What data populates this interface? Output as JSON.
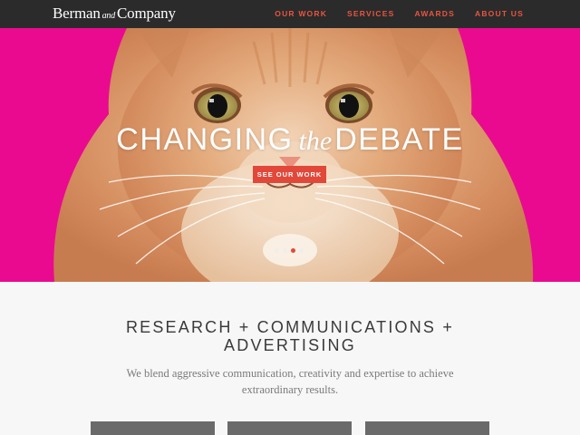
{
  "nav": {
    "logo_main": "Berman",
    "logo_and": "and",
    "logo_end": "Company",
    "items": [
      {
        "label": "OUR WORK"
      },
      {
        "label": "SERVICES"
      },
      {
        "label": "AWARDS"
      },
      {
        "label": "ABOUT US"
      }
    ]
  },
  "hero": {
    "headline_start": "CHANGING",
    "headline_italic": "the",
    "headline_end": "DEBATE",
    "cta_label": "SEE OUR WORK",
    "slides_total": 4,
    "active_slide": 3
  },
  "content": {
    "heading": "RESEARCH + COMMUNICATIONS + ADVERTISING",
    "lede": "We blend aggressive communication, creativity and expertise to achieve extraordinary results."
  },
  "colors": {
    "nav_bg": "#2b2b2b",
    "accent": "#e2483a",
    "hero_bg": "#ea0a8f",
    "page_bg": "#f7f7f7"
  }
}
